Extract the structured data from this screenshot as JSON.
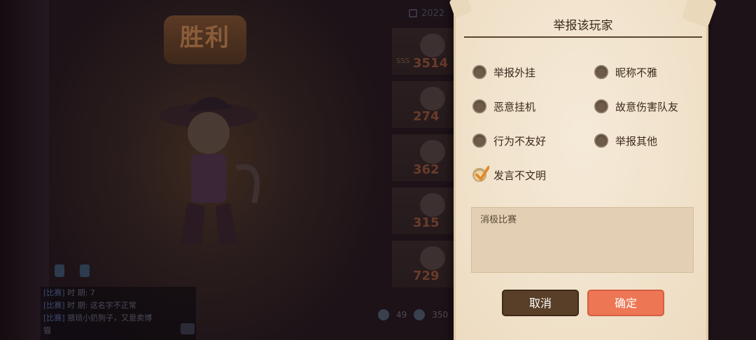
{
  "background": {
    "date_text": "2022",
    "victory_text": "胜利",
    "scores": [
      "3514",
      "274",
      "362",
      "315",
      "729"
    ],
    "score_badge": "SSS",
    "stats": [
      "49",
      "350"
    ],
    "chat_lines": [
      {
        "tag": "[比赛]",
        "text": "时      期: 7"
      },
      {
        "tag": "[比赛]",
        "text": "时      期: 这名字不正常"
      },
      {
        "tag": "[比赛]",
        "text": "猥琐小奶狗子，又是卖博"
      },
      {
        "tag": "",
        "text": "猫"
      }
    ]
  },
  "dialog": {
    "title": "举报该玩家",
    "options": [
      {
        "label": "举报外挂",
        "checked": false
      },
      {
        "label": "昵称不雅",
        "checked": false
      },
      {
        "label": "恶意挂机",
        "checked": false
      },
      {
        "label": "故意伤害队友",
        "checked": false
      },
      {
        "label": "行为不友好",
        "checked": false
      },
      {
        "label": "举报其他",
        "checked": false
      },
      {
        "label": "发言不文明",
        "checked": true
      }
    ],
    "comment_text": "消极比赛",
    "cancel_label": "取消",
    "confirm_label": "确定"
  },
  "colors": {
    "dialog_bg": "#f2e3cb",
    "cancel_button": "#5a3f28",
    "confirm_button": "#ed7655",
    "check_mark": "#e08a2c"
  }
}
